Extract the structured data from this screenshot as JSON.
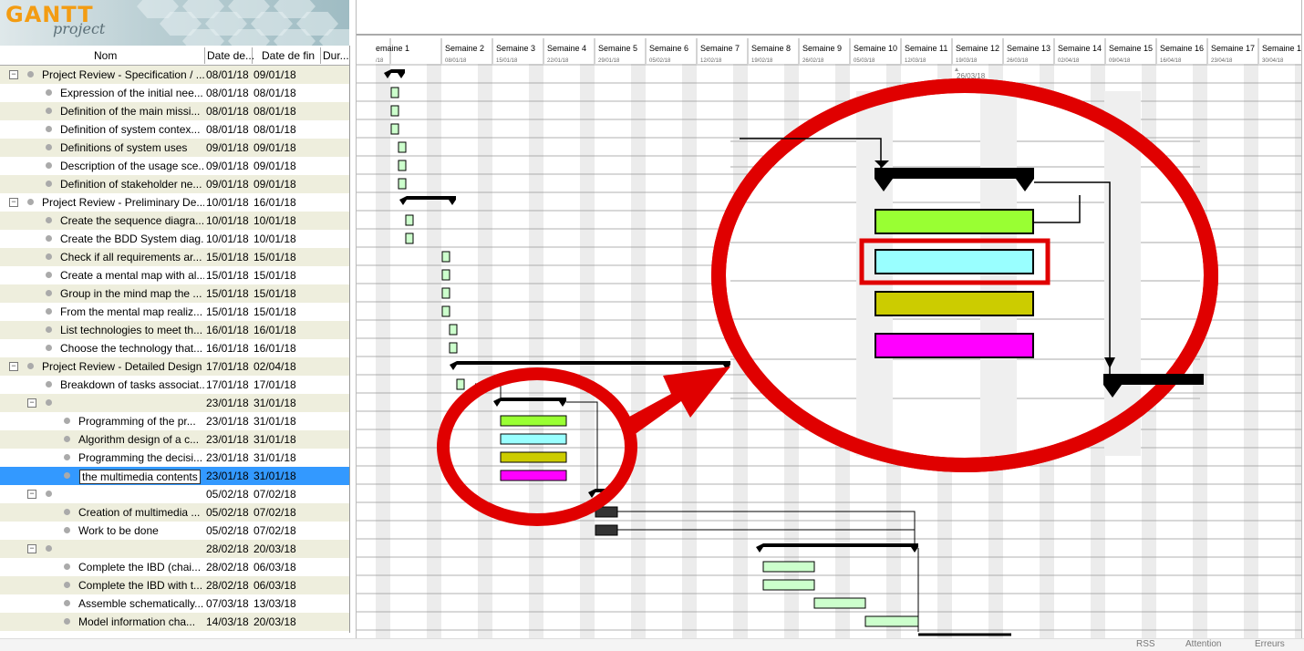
{
  "app": {
    "logo_main": "GANTT",
    "logo_sub": "project"
  },
  "columns": {
    "name": "Nom",
    "start": "Date de...",
    "end": "Date de fin",
    "duration": "Dur..."
  },
  "tasks": [
    {
      "name": "Project Review - Specification / ...",
      "start": "08/01/18",
      "end": "09/01/18",
      "level": 0,
      "group": true
    },
    {
      "name": "Expression of the initial nee...",
      "start": "08/01/18",
      "end": "08/01/18",
      "level": 1
    },
    {
      "name": "Definition of the main missi...",
      "start": "08/01/18",
      "end": "08/01/18",
      "level": 1
    },
    {
      "name": "Definition of system contex...",
      "start": "08/01/18",
      "end": "08/01/18",
      "level": 1
    },
    {
      "name": "Definitions of system uses",
      "start": "09/01/18",
      "end": "09/01/18",
      "level": 1
    },
    {
      "name": "Description of the usage sce...",
      "start": "09/01/18",
      "end": "09/01/18",
      "level": 1
    },
    {
      "name": "Definition of stakeholder ne...",
      "start": "09/01/18",
      "end": "09/01/18",
      "level": 1
    },
    {
      "name": "Project Review - Preliminary De...",
      "start": "10/01/18",
      "end": "16/01/18",
      "level": 0,
      "group": true
    },
    {
      "name": "Create the sequence diagra...",
      "start": "10/01/18",
      "end": "10/01/18",
      "level": 1
    },
    {
      "name": "Create the BDD System diag...",
      "start": "10/01/18",
      "end": "10/01/18",
      "level": 1
    },
    {
      "name": "Check if all requirements ar...",
      "start": "15/01/18",
      "end": "15/01/18",
      "level": 1
    },
    {
      "name": "Create a mental map with al...",
      "start": "15/01/18",
      "end": "15/01/18",
      "level": 1
    },
    {
      "name": "Group in the mind map the ...",
      "start": "15/01/18",
      "end": "15/01/18",
      "level": 1
    },
    {
      "name": "From the mental map realiz...",
      "start": "15/01/18",
      "end": "15/01/18",
      "level": 1
    },
    {
      "name": "List technologies to meet th...",
      "start": "16/01/18",
      "end": "16/01/18",
      "level": 1
    },
    {
      "name": "Choose the technology that...",
      "start": "16/01/18",
      "end": "16/01/18",
      "level": 1
    },
    {
      "name": "Project Review - Detailed Design",
      "start": "17/01/18",
      "end": "02/04/18",
      "level": 0,
      "group": true
    },
    {
      "name": "Breakdown of tasks associat...",
      "start": "17/01/18",
      "end": "17/01/18",
      "level": 1
    },
    {
      "name": "",
      "start": "23/01/18",
      "end": "31/01/18",
      "level": 1,
      "group": true
    },
    {
      "name": "Programming of the pr...",
      "start": "23/01/18",
      "end": "31/01/18",
      "level": 2
    },
    {
      "name": "Algorithm design of a c...",
      "start": "23/01/18",
      "end": "31/01/18",
      "level": 2
    },
    {
      "name": "Programming the decisi...",
      "start": "23/01/18",
      "end": "31/01/18",
      "level": 2
    },
    {
      "name": "the multimedia contents",
      "start": "23/01/18",
      "end": "31/01/18",
      "level": 2,
      "selected": true
    },
    {
      "name": "",
      "start": "05/02/18",
      "end": "07/02/18",
      "level": 1,
      "group": true
    },
    {
      "name": "Creation of multimedia ...",
      "start": "05/02/18",
      "end": "07/02/18",
      "level": 2
    },
    {
      "name": "Work to be done",
      "start": "05/02/18",
      "end": "07/02/18",
      "level": 2
    },
    {
      "name": "",
      "start": "28/02/18",
      "end": "20/03/18",
      "level": 1,
      "group": true
    },
    {
      "name": "Complete the IBD (chai...",
      "start": "28/02/18",
      "end": "06/03/18",
      "level": 2
    },
    {
      "name": "Complete the IBD with t...",
      "start": "28/02/18",
      "end": "06/03/18",
      "level": 2
    },
    {
      "name": "Assemble schematically...",
      "start": "07/03/18",
      "end": "13/03/18",
      "level": 2
    },
    {
      "name": "Model information cha...",
      "start": "14/03/18",
      "end": "20/03/18",
      "level": 2
    }
  ],
  "timeline": {
    "weeks": [
      "emaine 1",
      "Semaine 2",
      "Semaine 3",
      "Semaine 4",
      "Semaine 5",
      "Semaine 6",
      "Semaine 7",
      "Semaine 8",
      "Semaine 9",
      "Semaine 10",
      "Semaine 11",
      "Semaine 12",
      "Semaine 13",
      "Semaine 14",
      "Semaine 15",
      "Semaine 16",
      "Semaine 17",
      "Semaine 18",
      "Semaine 1"
    ],
    "dates": [
      "/18",
      "08/01/18",
      "15/01/18",
      "22/01/18",
      "29/01/18",
      "05/02/18",
      "12/02/18",
      "19/02/18",
      "26/02/18",
      "05/03/18",
      "12/03/18",
      "19/03/18",
      "26/03/18",
      "02/04/18",
      "09/04/18",
      "16/04/18",
      "23/04/18",
      "30/04/18",
      "07/05/18"
    ],
    "today_marker": "26/03/18"
  },
  "zoom_colors": {
    "green": "#99ff33",
    "cyan": "#99ffff",
    "olive": "#cccc00",
    "magenta": "#ff00ff"
  },
  "annotation_color": "#e00000",
  "status": {
    "rss": "RSS",
    "warning": "Attention",
    "errors": "Erreurs"
  }
}
